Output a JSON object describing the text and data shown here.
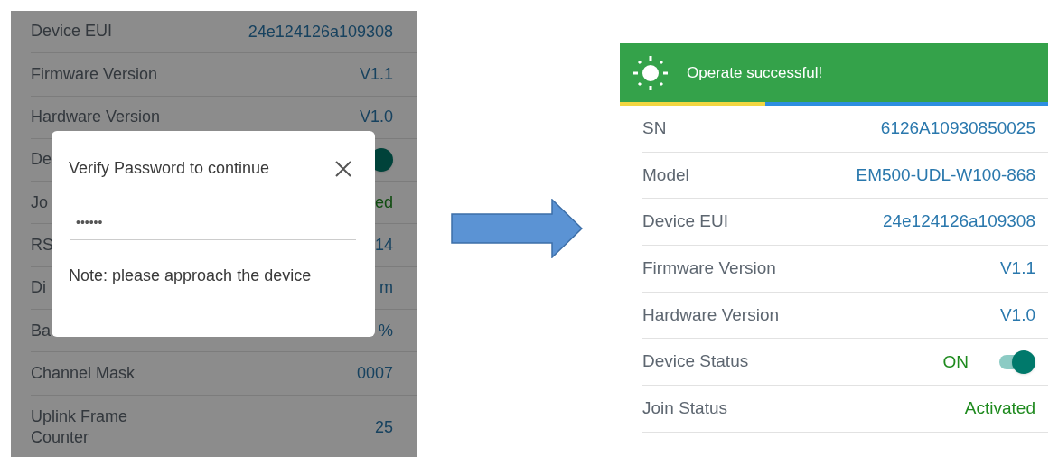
{
  "left_screen": {
    "rows": [
      {
        "label": "Device EUI",
        "value": "24e124126a109308",
        "kind": "text"
      },
      {
        "label": "Firmware Version",
        "value": "V1.1",
        "kind": "text"
      },
      {
        "label": "Hardware Version",
        "value": "V1.0",
        "kind": "text"
      },
      {
        "label": "De",
        "kind": "toggle",
        "on": true
      },
      {
        "label": "Jo",
        "value": "ed",
        "kind": "status"
      },
      {
        "label": "RS",
        "value": "14",
        "kind": "text"
      },
      {
        "label": "Di",
        "value": "m",
        "kind": "text"
      },
      {
        "label": "Ba",
        "value": "%",
        "kind": "text"
      },
      {
        "label": "Channel Mask",
        "value": "0007",
        "kind": "text"
      },
      {
        "label": "Uplink Frame Counter",
        "value": "25",
        "kind": "text"
      }
    ],
    "dialog": {
      "title": "Verify Password to continue",
      "password": "••••••",
      "note": "Note: please approach the device"
    }
  },
  "right_screen": {
    "toast": {
      "message": "Operate successful!",
      "level": 0.34
    },
    "rows": [
      {
        "label": "SN",
        "value": "6126A10930850025",
        "kind": "text"
      },
      {
        "label": "Model",
        "value": "EM500-UDL-W100-868",
        "kind": "text"
      },
      {
        "label": "Device EUI",
        "value": "24e124126a109308",
        "kind": "text"
      },
      {
        "label": "Firmware Version",
        "value": "V1.1",
        "kind": "text"
      },
      {
        "label": "Hardware Version",
        "value": "V1.0",
        "kind": "text"
      },
      {
        "label": "Device Status",
        "value": "ON",
        "kind": "toggle",
        "on": true
      },
      {
        "label": "Join Status",
        "value": "Activated",
        "kind": "status"
      }
    ]
  }
}
